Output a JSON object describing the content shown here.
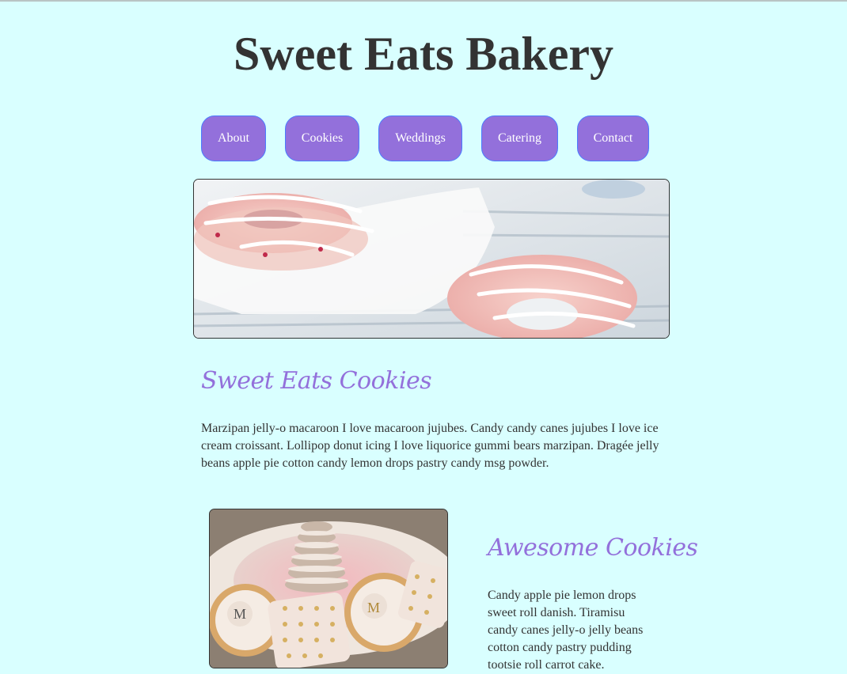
{
  "site": {
    "title": "Sweet Eats Bakery"
  },
  "nav": {
    "items": [
      {
        "label": "About"
      },
      {
        "label": "Cookies"
      },
      {
        "label": "Weddings"
      },
      {
        "label": "Catering"
      },
      {
        "label": "Contact"
      }
    ]
  },
  "main": {
    "heading": "Sweet Eats Cookies",
    "intro": "Marzipan jelly-o macaroon I love macaroon jujubes. Candy candy canes jujubes I love ice cream croissant. Lollipop donut icing I love liquorice gummi bears marzipan. Dragée jelly beans apple pie cotton candy lemon drops pastry candy msg powder."
  },
  "feature": {
    "heading": "Awesome Cookies",
    "text": "Candy apple pie lemon drops sweet roll danish. Tiramisu candy canes jelly-o jelly beans cotton candy pastry pudding tootsie roll carrot cake."
  },
  "colors": {
    "background": "#d9ffff",
    "accent": "#9370db",
    "nav_border": "#4a7dff",
    "text": "#333333"
  }
}
